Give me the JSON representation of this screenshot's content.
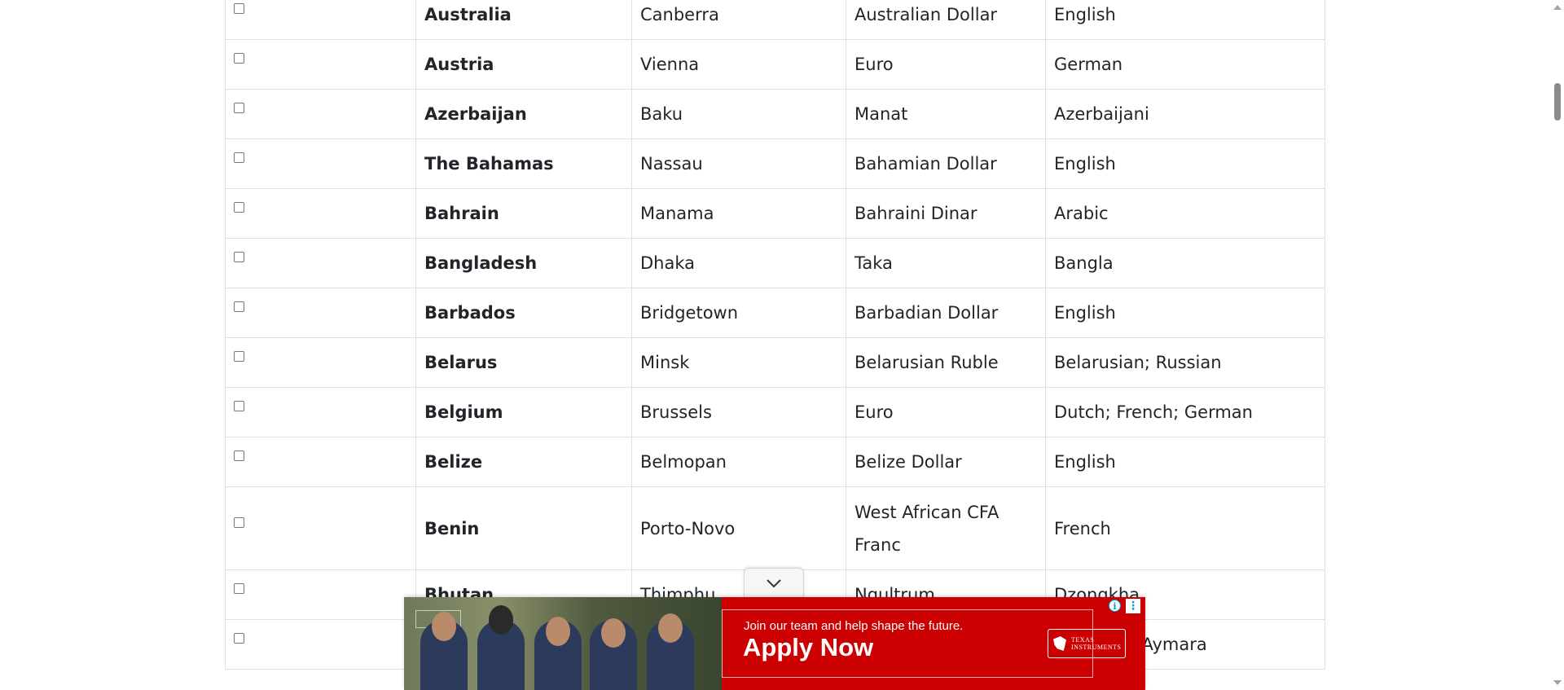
{
  "table": {
    "rows": [
      {
        "country": "Australia",
        "capital": "Canberra",
        "currency": "Australian Dollar",
        "language": "English"
      },
      {
        "country": "Austria",
        "capital": "Vienna",
        "currency": "Euro",
        "language": "German"
      },
      {
        "country": "Azerbaijan",
        "capital": "Baku",
        "currency": "Manat",
        "language": "Azerbaijani"
      },
      {
        "country": "The Bahamas",
        "capital": "Nassau",
        "currency": "Bahamian Dollar",
        "language": "English"
      },
      {
        "country": "Bahrain",
        "capital": "Manama",
        "currency": "Bahraini Dinar",
        "language": "Arabic"
      },
      {
        "country": "Bangladesh",
        "capital": "Dhaka",
        "currency": "Taka",
        "language": "Bangla"
      },
      {
        "country": "Barbados",
        "capital": "Bridgetown",
        "currency": "Barbadian Dollar",
        "language": "English"
      },
      {
        "country": "Belarus",
        "capital": "Minsk",
        "currency": "Belarusian Ruble",
        "language": "Belarusian; Russian"
      },
      {
        "country": "Belgium",
        "capital": "Brussels",
        "currency": "Euro",
        "language": "Dutch; French; German"
      },
      {
        "country": "Belize",
        "capital": "Belmopan",
        "currency": "Belize Dollar",
        "language": "English"
      },
      {
        "country": "Benin",
        "capital": "Porto-Novo",
        "currency": "West African CFA Franc",
        "language": "French"
      },
      {
        "country": "Bhutan",
        "capital": "Thimphu",
        "currency": "Ngultrum",
        "language": "Dzongkha"
      },
      {
        "country": "",
        "capital": "",
        "currency": "",
        "language": "Quechua; Aymara"
      }
    ]
  },
  "ad": {
    "tagline": "Join our team and help shape the future.",
    "cta": "Apply Now",
    "logo_line1": "TEXAS",
    "logo_line2": "INSTRUMENTS",
    "info_glyph": "i",
    "menu_glyph": "⋮",
    "brand_color": "#cc0000",
    "toggle_icon": "chevron-down-icon"
  },
  "scrollbar": {
    "thumb_color": "#8b8b8b"
  }
}
